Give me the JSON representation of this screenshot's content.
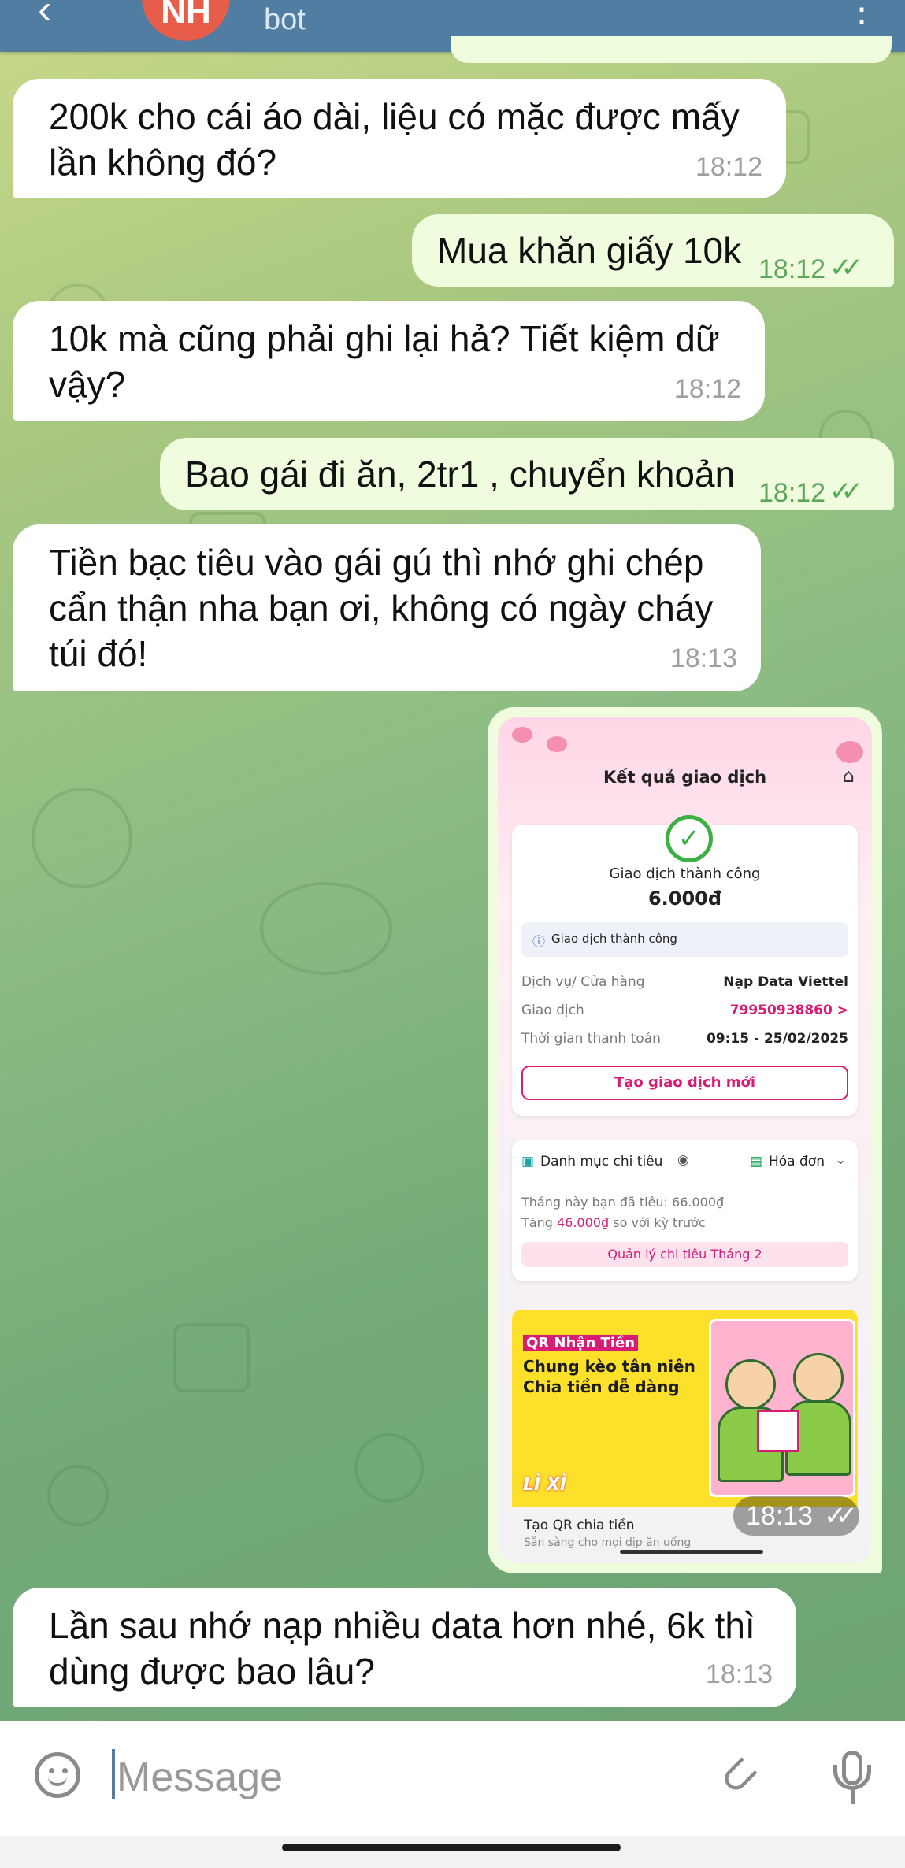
{
  "header": {
    "avatar_initials": "NH",
    "subtitle": "bot",
    "back_icon": "arrow-left-icon",
    "menu_icon": "more-vertical-icon"
  },
  "messages": [
    {
      "dir": "in",
      "text_lines": [
        "200k cho cái áo dài, liệu có mặc được mấy",
        "lần không đó?"
      ],
      "time": "18:12"
    },
    {
      "dir": "out",
      "text": "Mua khăn giấy 10k",
      "time": "18:12",
      "read": true
    },
    {
      "dir": "in",
      "text_lines": [
        "10k mà cũng phải ghi lại hả? Tiết kiệm dữ",
        "vậy?"
      ],
      "time": "18:12"
    },
    {
      "dir": "out",
      "text": "Bao gái đi ăn, 2tr1 , chuyển khoản",
      "time": "18:12",
      "read": true
    },
    {
      "dir": "in",
      "text_lines": [
        "Tiền bạc tiêu vào gái gú thì nhớ ghi chép",
        "cẩn thận nha bạn ơi, không có ngày cháy",
        "túi đó!"
      ],
      "time": "18:13"
    },
    {
      "dir": "in",
      "text_lines": [
        "Lần sau nhớ nạp nhiều data hơn nhé, 6k thì",
        "dùng được bao lâu?"
      ],
      "time": "18:13"
    }
  ],
  "image_message": {
    "time": "18:13",
    "screenshot": {
      "title": "Kết quả giao dịch",
      "status": "Giao dịch thành công",
      "amount": "6.000đ",
      "info": "Giao dịch thành công",
      "rows": [
        {
          "label": "Dịch vụ/ Cửa hàng",
          "value": "Nạp Data Viettel"
        },
        {
          "label": "Giao dịch",
          "value": "79950938860 >"
        },
        {
          "label": "Thời gian thanh toán",
          "value": "09:15 - 25/02/2025"
        }
      ],
      "new_tx_button": "Tạo giao dịch mới",
      "category_label": "Danh mục chi tiêu",
      "invoice_label": "Hóa đơn",
      "spent_text": "Tháng này bạn đã tiêu: 66.000₫",
      "increase_prefix": "Tăng ",
      "increase_value": "46.000₫",
      "increase_suffix": " so với kỳ trước",
      "manage_button": "Quản lý chi tiêu Tháng 2",
      "banner_tag": "QR Nhận Tiền",
      "banner_line1": "Chung kèo tân niên",
      "banner_line2": "Chia tiền dễ dàng",
      "banner_logo": "LÌ XÌ",
      "footer_title": "Tạo QR chia tiền",
      "footer_sub": "Sẵn sàng cho mọi dịp ăn uống"
    }
  },
  "input": {
    "placeholder": "Message",
    "emoji_icon": "smile-icon",
    "attach_icon": "paperclip-icon",
    "mic_icon": "microphone-icon"
  },
  "colors": {
    "header": "#517da2",
    "incoming_bubble": "#ffffff",
    "outgoing_bubble": "#effdde",
    "read_ticks": "#4fae4e",
    "accent_pink": "#d81b74"
  }
}
